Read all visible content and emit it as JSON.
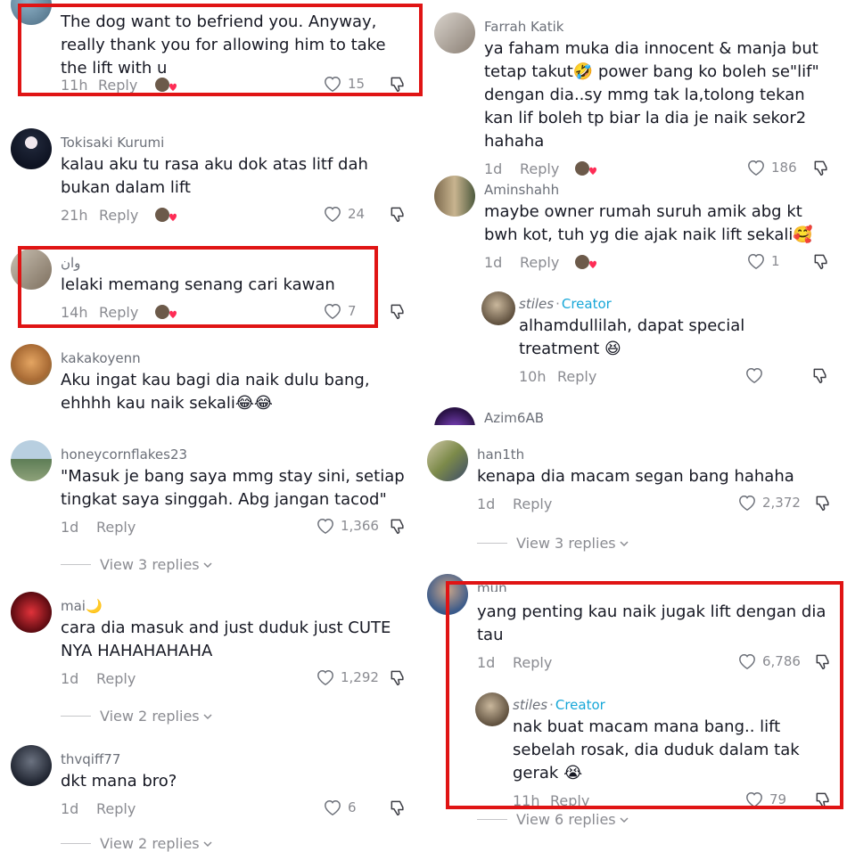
{
  "left": [
    {
      "id": "c0",
      "username": "",
      "text": "The dog want to befriend you. Anyway, really thank you for allowing him to take the lift with u",
      "time": "11h",
      "reply": "Reply",
      "likes": "15"
    },
    {
      "id": "c1",
      "username": "Tokisaki Kurumi",
      "text": "kalau aku tu rasa aku dok atas litf dah bukan dalam lift",
      "time": "21h",
      "reply": "Reply",
      "likes": "24"
    },
    {
      "id": "c2",
      "username": "وان",
      "text": "lelaki memang senang cari kawan",
      "time": "14h",
      "reply": "Reply",
      "likes": "7"
    },
    {
      "id": "c3",
      "username": "kakakoyenn",
      "text": "Aku ingat kau bagi dia naik dulu bang, ehhhh kau naik sekali😂😂"
    },
    {
      "id": "c4",
      "username": "honeycornflakes23",
      "text": "\"Masuk je bang saya mmg stay sini, setiap tingkat saya singgah. Abg jangan tacod\"",
      "time": "1d",
      "reply": "Reply",
      "likes": "1,366",
      "view": "View 3 replies"
    },
    {
      "id": "c5",
      "username": "mai🌙",
      "text": "cara dia masuk and just duduk just CUTE NYA HAHAHAHAHA",
      "time": "1d",
      "reply": "Reply",
      "likes": "1,292",
      "view": "View 2 replies"
    },
    {
      "id": "c6",
      "username": "thvqiff77",
      "text": "dkt mana bro?",
      "time": "1d",
      "reply": "Reply",
      "likes": "6",
      "view": "View 2 replies"
    }
  ],
  "right": [
    {
      "id": "r0",
      "username": "Farrah Katik",
      "text": "ya faham muka dia innocent & manja but tetap takut🤣 power bang ko boleh se\"lif\" dengan dia..sy mmg tak la,tolong tekan kan lif boleh tp biar la dia je naik sekor2 hahaha",
      "time": "1d",
      "reply": "Reply",
      "likes": "186"
    },
    {
      "id": "r1",
      "username": "Aminshahh",
      "text": "maybe owner rumah suruh amik abg kt bwh kot, tuh yg die ajak naik lift sekali🥰",
      "time": "1d",
      "reply": "Reply",
      "likes": "1"
    },
    {
      "id": "r2",
      "username": "stiles",
      "creator": "Creator",
      "text": "alhamdullilah, dapat special treatment 😆",
      "time": "10h",
      "reply": "Reply",
      "likes": ""
    },
    {
      "id": "r3",
      "username": "Azim6AB"
    },
    {
      "id": "r4",
      "username": "han1th",
      "text": "kenapa dia macam segan bang hahaha",
      "time": "1d",
      "reply": "Reply",
      "likes": "2,372",
      "view": "View 3 replies"
    },
    {
      "id": "r5",
      "username": "mun",
      "text": "yang penting kau naik jugak lift dengan dia tau",
      "time": "1d",
      "reply": "Reply",
      "likes": "6,786"
    },
    {
      "id": "r6",
      "username": "stiles",
      "creator": "Creator",
      "text": "nak buat macam mana bang.. lift sebelah rosak, dia duduk dalam tak gerak 😭",
      "time": "11h",
      "reply": "Reply",
      "likes": "79",
      "view": "View 6 replies"
    }
  ],
  "icons": {
    "heart": "heart-outline-icon",
    "dislike": "thumbs-down-icon",
    "chevron": "chevron-down-icon"
  },
  "colors": {
    "highlight": "#e01414",
    "creator": "#17a7d8",
    "muted": "#8a8b91"
  }
}
